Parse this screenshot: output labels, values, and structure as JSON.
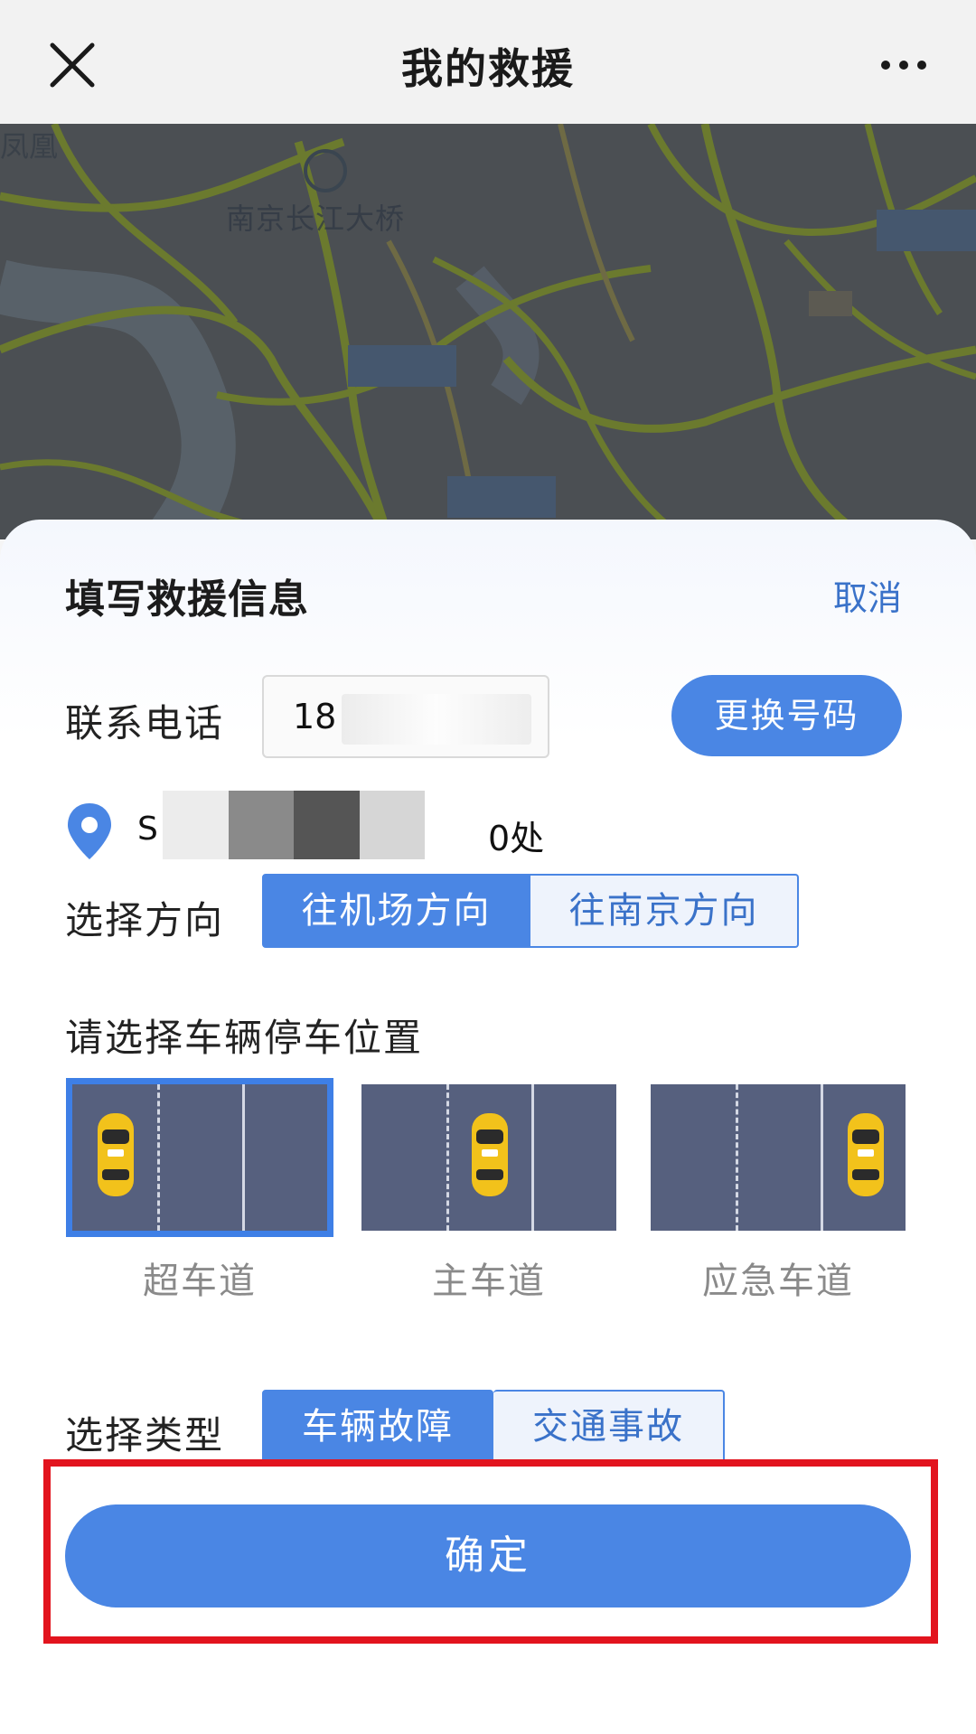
{
  "header": {
    "title": "我的救援",
    "close_icon": "close-icon",
    "more_icon": "more-icon"
  },
  "map": {
    "bridge_label": "南京长江大桥",
    "corner_label": "凤凰"
  },
  "sheet": {
    "title": "填写救援信息",
    "cancel_label": "取消",
    "phone": {
      "label": "联系电话",
      "prefix": "18",
      "change_label": "更换号码"
    },
    "location": {
      "icon": "location-pin-icon",
      "start": "S",
      "end": "0处"
    },
    "direction": {
      "label": "选择方向",
      "options": [
        "往机场方向",
        "往南京方向"
      ],
      "selected": "往机场方向"
    },
    "parking": {
      "label": "请选择车辆停车位置",
      "lanes": [
        "超车道",
        "主车道",
        "应急车道"
      ],
      "selected": "超车道"
    },
    "type": {
      "label": "选择类型",
      "options": [
        "车辆故障",
        "交通事故"
      ],
      "selected": "车辆故障"
    },
    "confirm_label": "确定"
  },
  "colors": {
    "accent": "#4a86e4",
    "link": "#3a72c9",
    "highlight_frame": "#e2141e",
    "lane": "#56607e"
  }
}
